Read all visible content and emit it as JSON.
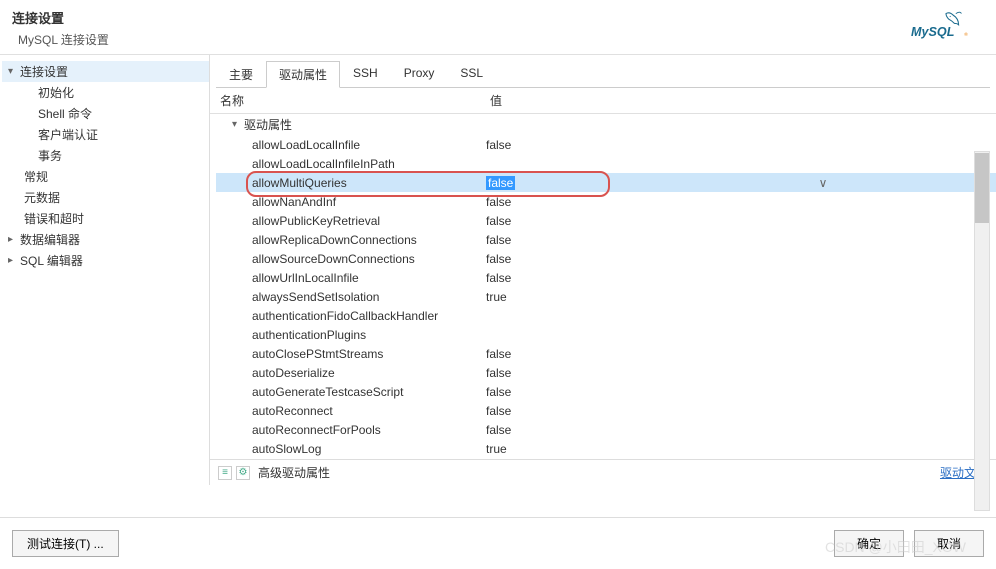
{
  "header": {
    "title": "连接设置",
    "subtitle": "MySQL 连接设置"
  },
  "sidebar": {
    "items": [
      {
        "label": "连接设置",
        "indent": 0,
        "toggle": "▾",
        "selected": true
      },
      {
        "label": "初始化",
        "indent": 2
      },
      {
        "label": "Shell 命令",
        "indent": 2
      },
      {
        "label": "客户端认证",
        "indent": 2
      },
      {
        "label": "事务",
        "indent": 2
      },
      {
        "label": "常规",
        "indent": 1
      },
      {
        "label": "元数据",
        "indent": 1
      },
      {
        "label": "错误和超时",
        "indent": 1
      },
      {
        "label": "数据编辑器",
        "indent": 0,
        "toggle": "▸"
      },
      {
        "label": "SQL 编辑器",
        "indent": 0,
        "toggle": "▸"
      }
    ]
  },
  "tabs": [
    {
      "label": "主要"
    },
    {
      "label": "驱动属性"
    },
    {
      "label": "SSH"
    },
    {
      "label": "Proxy"
    },
    {
      "label": "SSL"
    }
  ],
  "table": {
    "col_name": "名称",
    "col_value": "值",
    "group": "驱动属性",
    "props": [
      {
        "name": "allowLoadLocalInfile",
        "value": "false"
      },
      {
        "name": "allowLoadLocalInfileInPath",
        "value": ""
      },
      {
        "name": "allowMultiQueries",
        "value": "false",
        "selected": true
      },
      {
        "name": "allowNanAndInf",
        "value": "false"
      },
      {
        "name": "allowPublicKeyRetrieval",
        "value": "false"
      },
      {
        "name": "allowReplicaDownConnections",
        "value": "false"
      },
      {
        "name": "allowSourceDownConnections",
        "value": "false"
      },
      {
        "name": "allowUrlInLocalInfile",
        "value": "false"
      },
      {
        "name": "alwaysSendSetIsolation",
        "value": "true"
      },
      {
        "name": "authenticationFidoCallbackHandler",
        "value": ""
      },
      {
        "name": "authenticationPlugins",
        "value": ""
      },
      {
        "name": "autoClosePStmtStreams",
        "value": "false"
      },
      {
        "name": "autoDeserialize",
        "value": "false"
      },
      {
        "name": "autoGenerateTestcaseScript",
        "value": "false"
      },
      {
        "name": "autoReconnect",
        "value": "false"
      },
      {
        "name": "autoReconnectForPools",
        "value": "false"
      },
      {
        "name": "autoSlowLog",
        "value": "true"
      }
    ]
  },
  "bottom": {
    "adv_label": "高级驱动属性",
    "link": "驱动文档"
  },
  "footer": {
    "test_btn": "测试连接(T)  ...",
    "ok_btn": "确定",
    "cancel_btn": "取消"
  },
  "watermark": "CSDN @小田田_XOW"
}
